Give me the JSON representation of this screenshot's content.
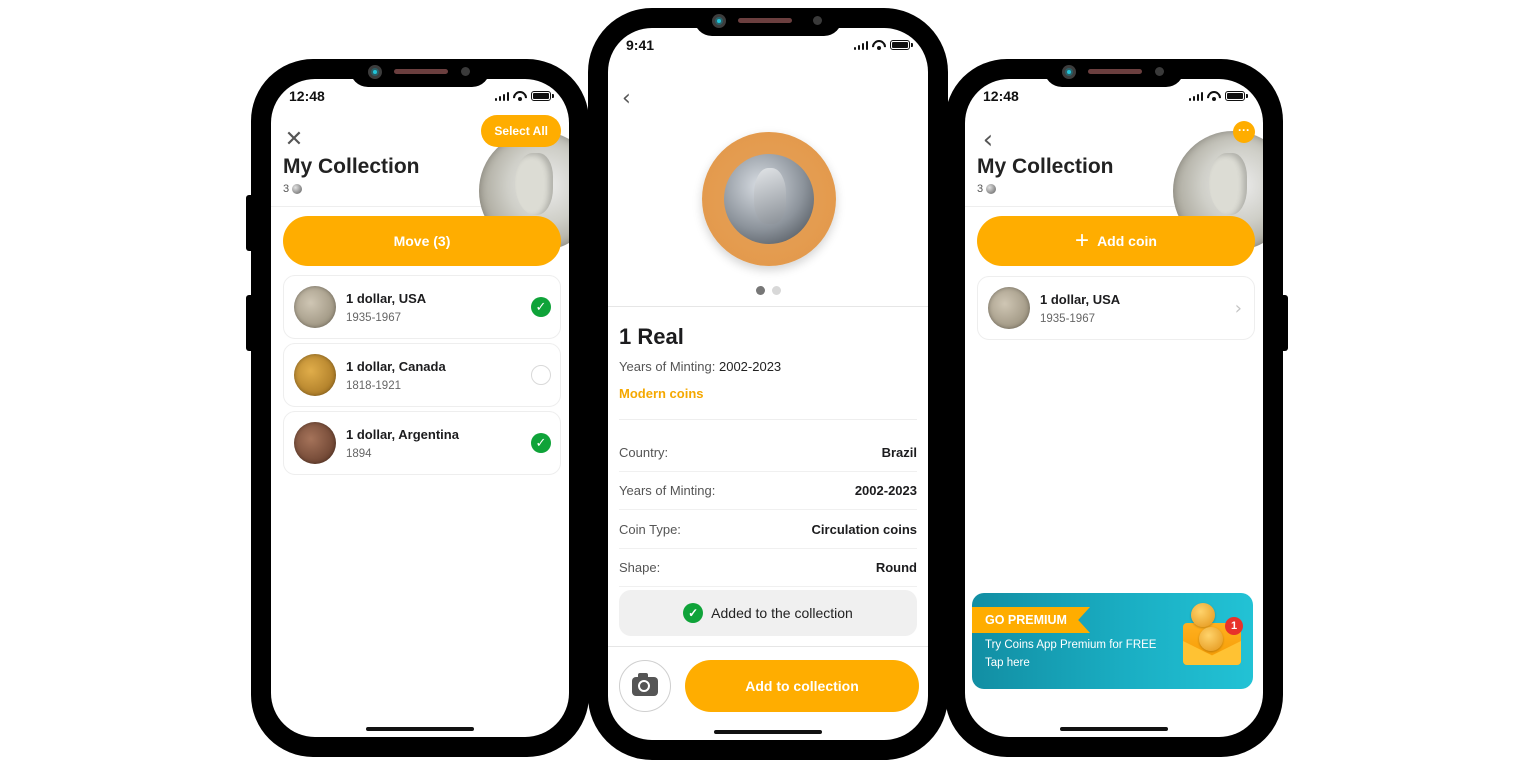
{
  "colors": {
    "accent": "#FFAD00",
    "success": "#0FA339",
    "premium_gradient_start": "#128EA3",
    "premium_gradient_end": "#22C2D5",
    "badge": "#E8322A",
    "frame": "#000000"
  },
  "phones": {
    "left": {
      "status_time": "12:48",
      "header": {
        "close_icon": "close-icon",
        "title": "My Collection",
        "count": "3",
        "select_all_label": "Select All"
      },
      "move_button_label": "Move (3)",
      "coins": [
        {
          "name": "1 dollar, USA",
          "years": "1935-1967",
          "selected": true
        },
        {
          "name": "1 dollar, Canada",
          "years": "1818-1921",
          "selected": false
        },
        {
          "name": "1 dollar, Argentina",
          "years": "1894",
          "selected": true
        }
      ]
    },
    "middle": {
      "status_time": "9:41",
      "back_icon": "chevron-left-icon",
      "image_pager": {
        "pages": 2,
        "active": 1
      },
      "coin": {
        "title": "1 Real",
        "minting_label": "Years of Minting:",
        "minting_value": "2002-2023",
        "category": "Modern coins"
      },
      "details": [
        {
          "label": "Country:",
          "value": "Brazil"
        },
        {
          "label": "Years of Minting:",
          "value": "2002-2023"
        },
        {
          "label": "Coin Type:",
          "value": "Circulation coins"
        },
        {
          "label": "Shape:",
          "value": "Round"
        }
      ],
      "added_status": "Added to the collection",
      "camera_icon": "camera-icon",
      "add_button_label": "Add to collection"
    },
    "right": {
      "status_time": "12:48",
      "header": {
        "back_icon": "chevron-left-icon",
        "title": "My Collection",
        "count": "3",
        "more_icon": "more-horizontal-icon"
      },
      "add_coin_label": "Add coin",
      "coins": [
        {
          "name": "1 dollar, USA",
          "years": "1935-1967"
        }
      ],
      "premium": {
        "ribbon": "GO PREMIUM",
        "line1": "Try Coins App Premium for FREE",
        "line2": "Tap here",
        "badge_count": "1"
      }
    }
  }
}
